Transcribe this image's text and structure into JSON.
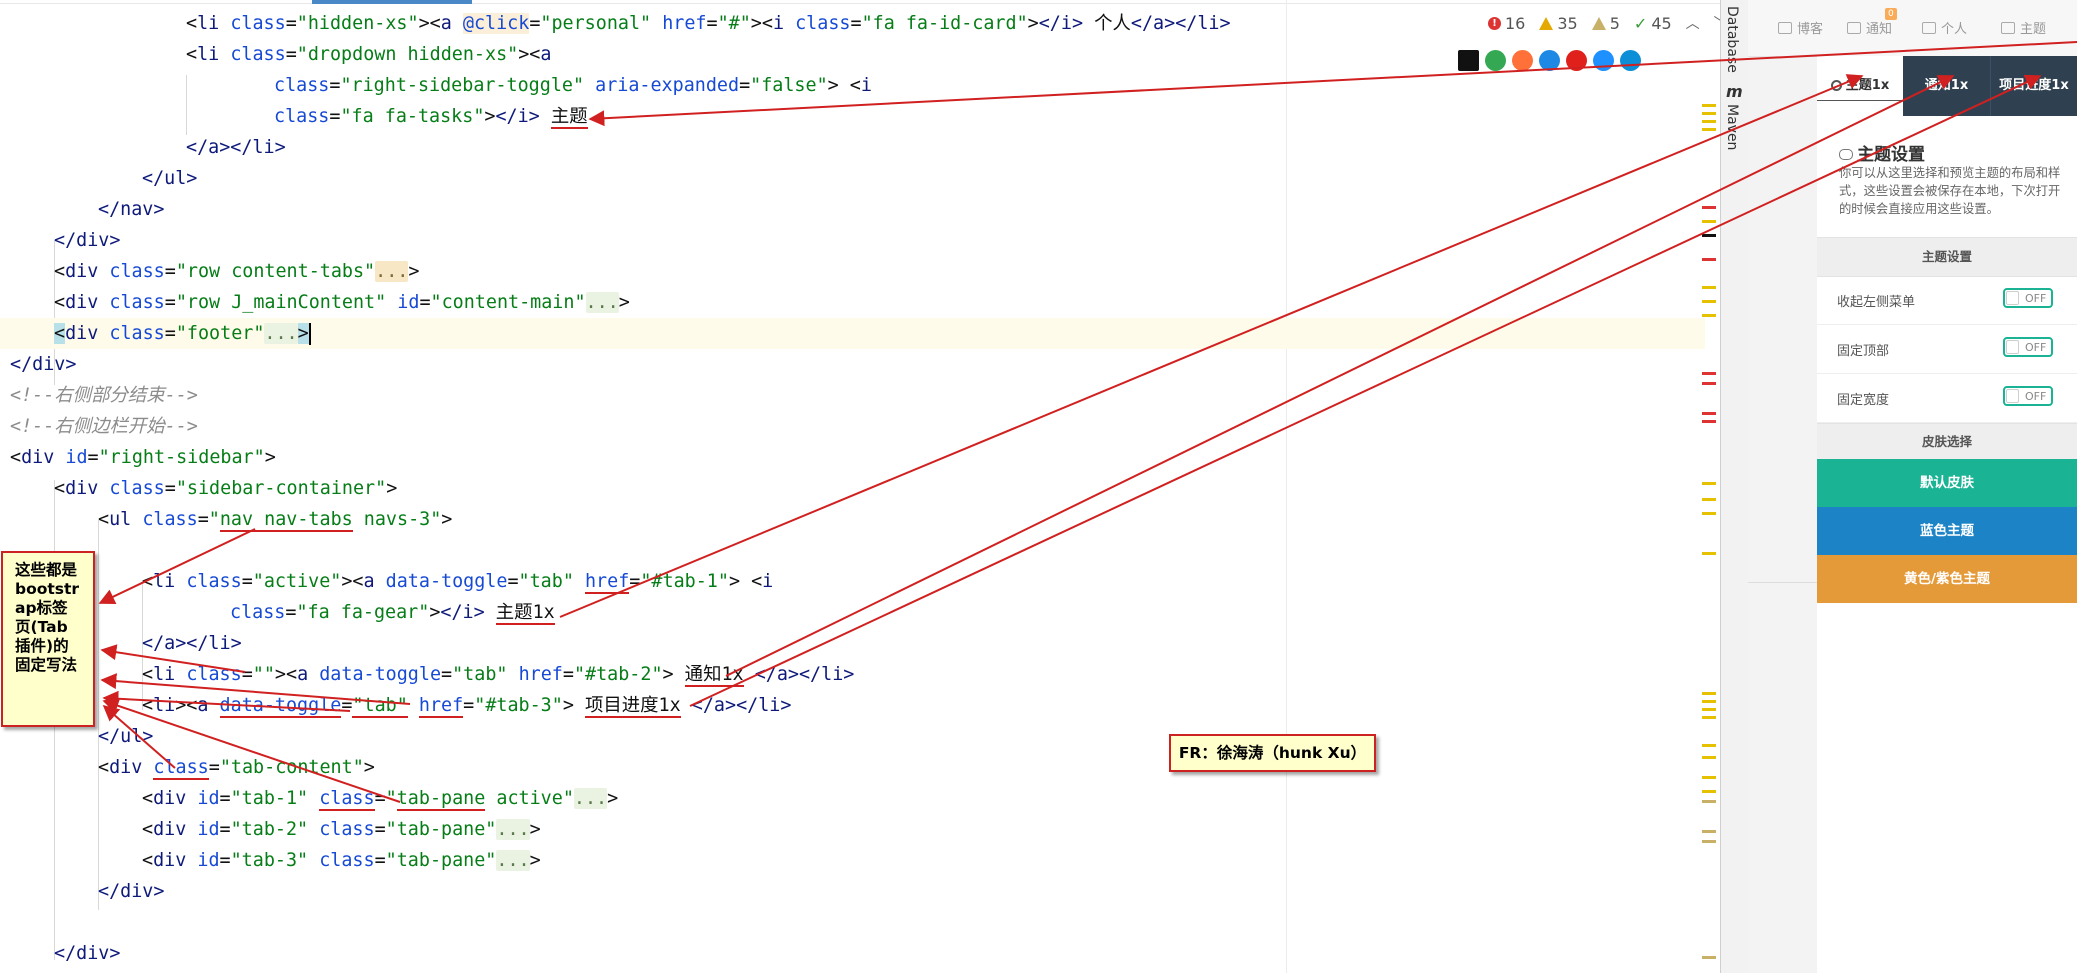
{
  "editor": {
    "inspections": {
      "errors": "16",
      "warnings": "35",
      "weak_warnings": "5",
      "ok": "45"
    },
    "browser_icons": [
      {
        "name": "jetbrains-icon",
        "color": "#111111"
      },
      {
        "name": "chrome-icon",
        "color": "#34a853"
      },
      {
        "name": "firefox-icon",
        "color": "#ff7139"
      },
      {
        "name": "safari-icon",
        "color": "#1e88e5"
      },
      {
        "name": "opera-icon",
        "color": "#e0201b"
      },
      {
        "name": "ie-icon",
        "color": "#1e90ff"
      },
      {
        "name": "edge-icon",
        "color": "#0c8fd6"
      }
    ],
    "code": {
      "l1": {
        "t_li": "li",
        "a_class": "class",
        "v_hidden": "\"hidden-xs\"",
        "t_a": "a",
        "a_click": "@click",
        "v_personal": "\"personal\"",
        "a_href": "href",
        "v_hash": "\"#\"",
        "t_i": "i",
        "a_class2": "class",
        "v_idcard": "\"fa fa-id-card\"",
        "t_i_close": "</i>",
        "text": "个人",
        "t_a_close": "</a>",
        "t_li_close": "</li>"
      },
      "l2": {
        "t_li": "li",
        "a_class": "class",
        "v": "\"dropdown hidden-xs\"",
        "t_a": "a"
      },
      "l3": {
        "a_class": "class",
        "v_class": "\"right-sidebar-toggle\"",
        "a_aria": "aria-expanded",
        "v_aria": "\"false\"",
        "t_i": "i"
      },
      "l4": {
        "a_class": "class",
        "v_class": "\"fa fa-tasks\"",
        "t_i_close": "</i>",
        "text": "主题"
      },
      "l5": {
        "t": "</a></li>"
      },
      "l6": {
        "t": "</ul>"
      },
      "l7": {
        "t": "</nav>"
      },
      "l8": {
        "t": "</div>"
      },
      "l9": {
        "t_div": "div",
        "a_class": "class",
        "v_class": "\"row content-tabs\"",
        "fold": "..."
      },
      "l10": {
        "t_div": "div",
        "a_class": "class",
        "v_class": "\"row J_mainContent\"",
        "a_id": "id",
        "v_id": "\"content-main\"",
        "fold": "..."
      },
      "l11": {
        "t_div": "div",
        "a_class": "class",
        "v_class": "\"footer\"",
        "fold": "..."
      },
      "l12": {
        "t": "</div>"
      },
      "l13": {
        "comment": "<!--右侧部分结束-->"
      },
      "l14": {
        "comment": "<!--右侧边栏开始-->"
      },
      "l15": {
        "t_div": "div",
        "a_id": "id",
        "v_id": "\"right-sidebar\""
      },
      "l16": {
        "t_div": "div",
        "a_class": "class",
        "v_class": "\"sidebar-container\""
      },
      "l17": {
        "t_ul": "ul",
        "a_class": "class",
        "v_q": "\"",
        "v_u": "nav nav-tabs",
        "v_rest": " navs-3\""
      },
      "l19": {
        "t_li": "li",
        "a_class": "class",
        "v_class": "\"active\"",
        "t_a": "a",
        "a_toggle": "data-toggle",
        "v_toggle": "\"tab\"",
        "a_href": "href",
        "v_href": "\"#tab-1\"",
        "t_i": "i"
      },
      "l20": {
        "a_class": "class",
        "v_class": "\"fa fa-gear\"",
        "t_i_close": "</i>",
        "text": "主题1x"
      },
      "l21": {
        "t": "</a></li>"
      },
      "l22": {
        "t_li": "li",
        "a_class": "class",
        "v_class": "\"\"",
        "t_a": "a",
        "a_toggle": "data-toggle",
        "v_toggle": "\"tab\"",
        "a_href": "href",
        "v_href": "\"#tab-2\"",
        "text": "通知1x",
        "t_close": "</a></li>"
      },
      "l23": {
        "t_li": "li",
        "t_a": "a",
        "a_toggle": "data-toggle",
        "v_toggle": "\"tab\"",
        "a_href": "href",
        "v_href": "\"#tab-3\"",
        "text": "项目进度1x",
        "t_close": "</a></li>"
      },
      "l24": {
        "t": "</ul>"
      },
      "l25": {
        "t_div": "div",
        "a_class": "class",
        "v_class": "\"tab-content\""
      },
      "l26": {
        "t_div": "div",
        "a_id": "id",
        "v_id": "\"tab-1\"",
        "a_class": "class",
        "v_q": "\"",
        "v_u": "tab-pane",
        "v_rest": " active\"",
        "fold": "..."
      },
      "l27": {
        "t_div": "div",
        "a_id": "id",
        "v_id": "\"tab-2\"",
        "a_class": "class",
        "v_class": "\"tab-pane\"",
        "fold": "..."
      },
      "l28": {
        "t_div": "div",
        "a_id": "id",
        "v_id": "\"tab-3\"",
        "a_class": "class",
        "v_class": "\"tab-pane\"",
        "fold": "..."
      },
      "l29": {
        "t": "</div>"
      },
      "l31": {
        "t": "</div>"
      }
    }
  },
  "toolstrip": {
    "database": "Database",
    "maven_icon": "m",
    "maven": "Maven"
  },
  "preview": {
    "topnav": {
      "blog": "博客",
      "notify": "通知",
      "notify_badge": "0",
      "personal": "个人",
      "theme": "主题"
    },
    "tabs": {
      "theme": "主题1x",
      "notify": "通知1x",
      "progress": "项目进度1x"
    },
    "title": "主题设置",
    "desc": "你可以从这里选择和预览主题的布局和样式，这些设置会被保存在本地，下次打开的时候会直接应用这些设置。",
    "section_theme": "主题设置",
    "options": [
      {
        "label": "收起左侧菜单",
        "state": "OFF"
      },
      {
        "label": "固定顶部",
        "state": "OFF"
      },
      {
        "label": "固定宽度",
        "state": "OFF"
      }
    ],
    "section_skin": "皮肤选择",
    "skins": [
      {
        "label": "默认皮肤",
        "color": "#1ab394"
      },
      {
        "label": "蓝色主题",
        "color": "#1c84c6"
      },
      {
        "label": "黄色/紫色主题",
        "color": "#e59a3a"
      }
    ],
    "accent": "#1ab394",
    "dark_tab": "#2f4050"
  },
  "annotations": {
    "note": "这些都是bootstrap标签页(Tab插件)的固定写法",
    "fr": "FR：徐海涛（hunk Xu）",
    "arrow_color": "#d12020"
  }
}
